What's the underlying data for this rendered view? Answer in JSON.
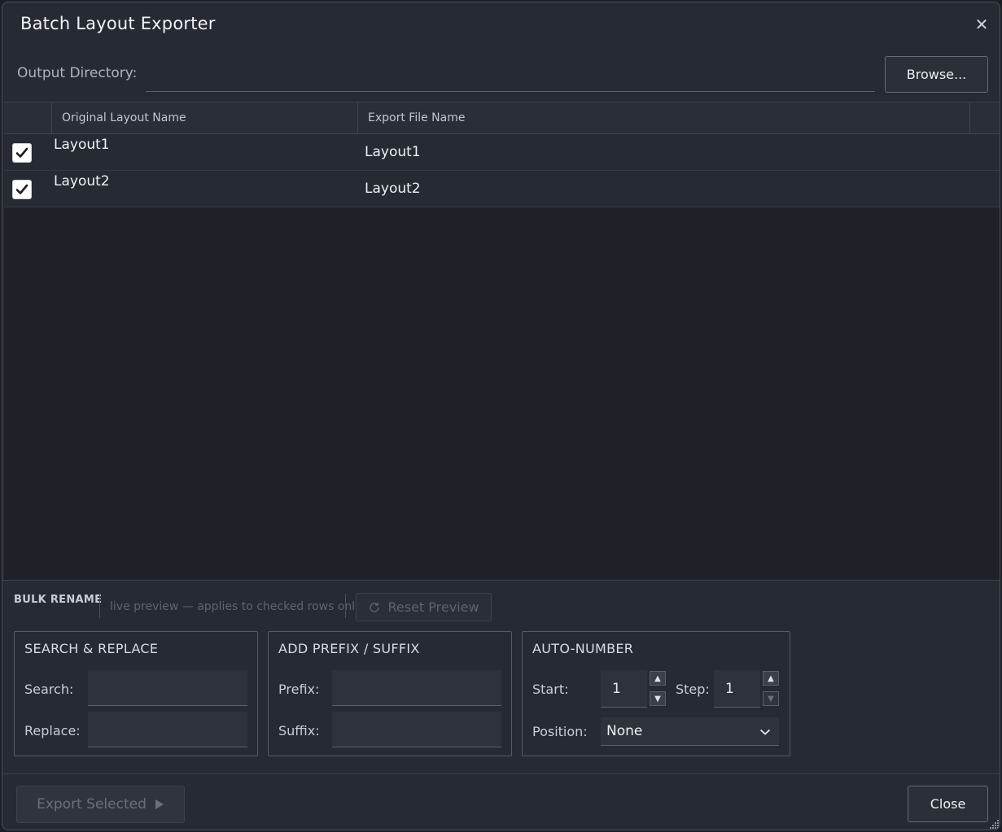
{
  "dialog": {
    "title": "Batch Layout Exporter",
    "close_icon": "close-icon"
  },
  "output": {
    "label": "Output Directory:",
    "value": "",
    "browse_label": "Browse..."
  },
  "table": {
    "columns": [
      "",
      "Original Layout Name",
      "Export File Name"
    ],
    "rows": [
      {
        "checked": true,
        "original": "Layout1",
        "export": "Layout1"
      },
      {
        "checked": true,
        "original": "Layout2",
        "export": "Layout2"
      }
    ]
  },
  "bulk": {
    "label": "BULK RENAME",
    "hint": "live preview — applies to checked rows only",
    "reset_label": "Reset Preview",
    "search_replace": {
      "title": "SEARCH & REPLACE",
      "search_label": "Search:",
      "search_value": "",
      "replace_label": "Replace:",
      "replace_value": ""
    },
    "prefix_suffix": {
      "title": "ADD PREFIX / SUFFIX",
      "prefix_label": "Prefix:",
      "prefix_value": "",
      "suffix_label": "Suffix:",
      "suffix_value": ""
    },
    "auto_number": {
      "title": "AUTO-NUMBER",
      "start_label": "Start:",
      "start_value": "1",
      "step_label": "Step:",
      "step_value": "1",
      "position_label": "Position:",
      "position_value": "None"
    }
  },
  "footer": {
    "export_label": "Export Selected",
    "close_label": "Close"
  },
  "colors": {
    "background": "#262a33",
    "table_bg": "#1e2128",
    "border": "#555a65",
    "disabled_text": "#5e636d"
  }
}
